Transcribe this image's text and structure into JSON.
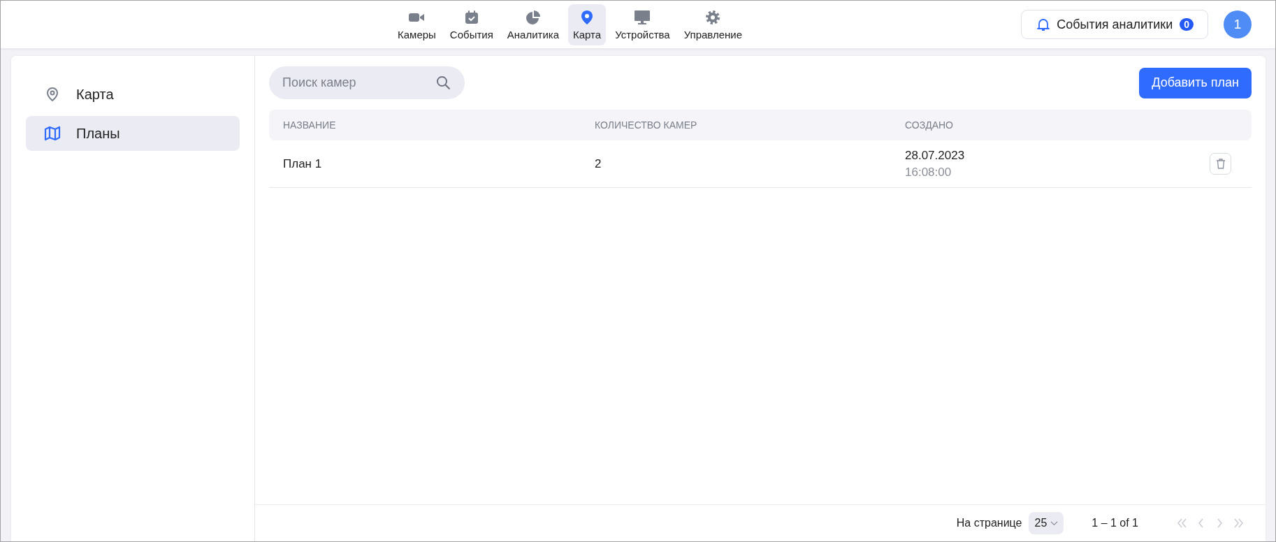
{
  "top_nav": {
    "items": [
      {
        "label": "Камеры",
        "selected": false
      },
      {
        "label": "События",
        "selected": false
      },
      {
        "label": "Аналитика",
        "selected": false
      },
      {
        "label": "Карта",
        "selected": true
      },
      {
        "label": "Устройства",
        "selected": false
      },
      {
        "label": "Управление",
        "selected": false
      }
    ]
  },
  "analytics_button": {
    "label": "События аналитики",
    "badge": "0"
  },
  "avatar": {
    "label": "1"
  },
  "sidebar": {
    "items": [
      {
        "label": "Карта",
        "selected": false
      },
      {
        "label": "Планы",
        "selected": true
      }
    ]
  },
  "search": {
    "placeholder": "Поиск камер"
  },
  "add_button": "Добавить план",
  "table": {
    "columns": [
      "НАЗВАНИЕ",
      "КОЛИЧЕСТВО КАМЕР",
      "СОЗДАНО"
    ],
    "rows": [
      {
        "name": "План 1",
        "cameras": "2",
        "created_date": "28.07.2023",
        "created_time": "16:08:00"
      }
    ]
  },
  "pagination": {
    "per_page_label": "На странице",
    "per_page": "25",
    "range": "1 – 1 of 1",
    "buttons": [
      {
        "kind": "first",
        "disabled": true
      },
      {
        "kind": "prev",
        "disabled": true
      },
      {
        "kind": "next",
        "disabled": true
      },
      {
        "kind": "last",
        "disabled": true
      }
    ]
  }
}
